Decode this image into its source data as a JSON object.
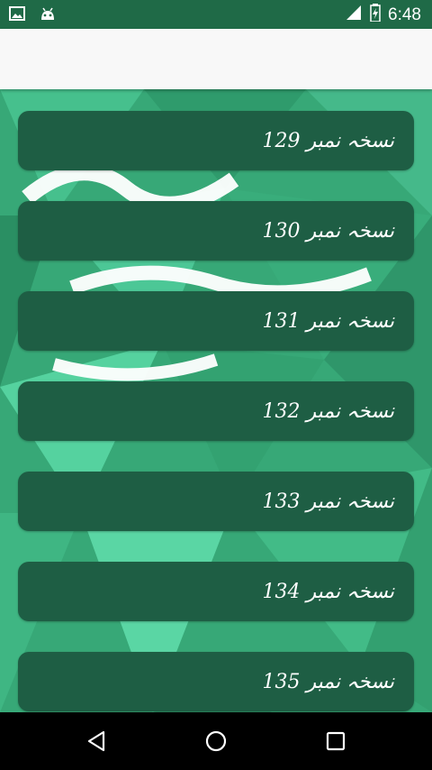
{
  "status_bar": {
    "time": "6:48",
    "icons": [
      "image-icon",
      "android-icon",
      "signal-icon",
      "battery-icon"
    ]
  },
  "app_bar": {
    "title": ""
  },
  "list": {
    "items": [
      {
        "label": "نسخہ نمبر 129"
      },
      {
        "label": "نسخہ نمبر 130"
      },
      {
        "label": "نسخہ نمبر 131"
      },
      {
        "label": "نسخہ نمبر 132"
      },
      {
        "label": "نسخہ نمبر 133"
      },
      {
        "label": "نسخہ نمبر 134"
      },
      {
        "label": "نسخہ نمبر 135"
      }
    ]
  },
  "nav_bar": {
    "buttons": [
      "back-icon",
      "home-icon",
      "recents-icon"
    ]
  },
  "colors": {
    "status_bar": "#1f6a47",
    "item_background": "#1e5e44",
    "background_green": "#3bb07f"
  }
}
